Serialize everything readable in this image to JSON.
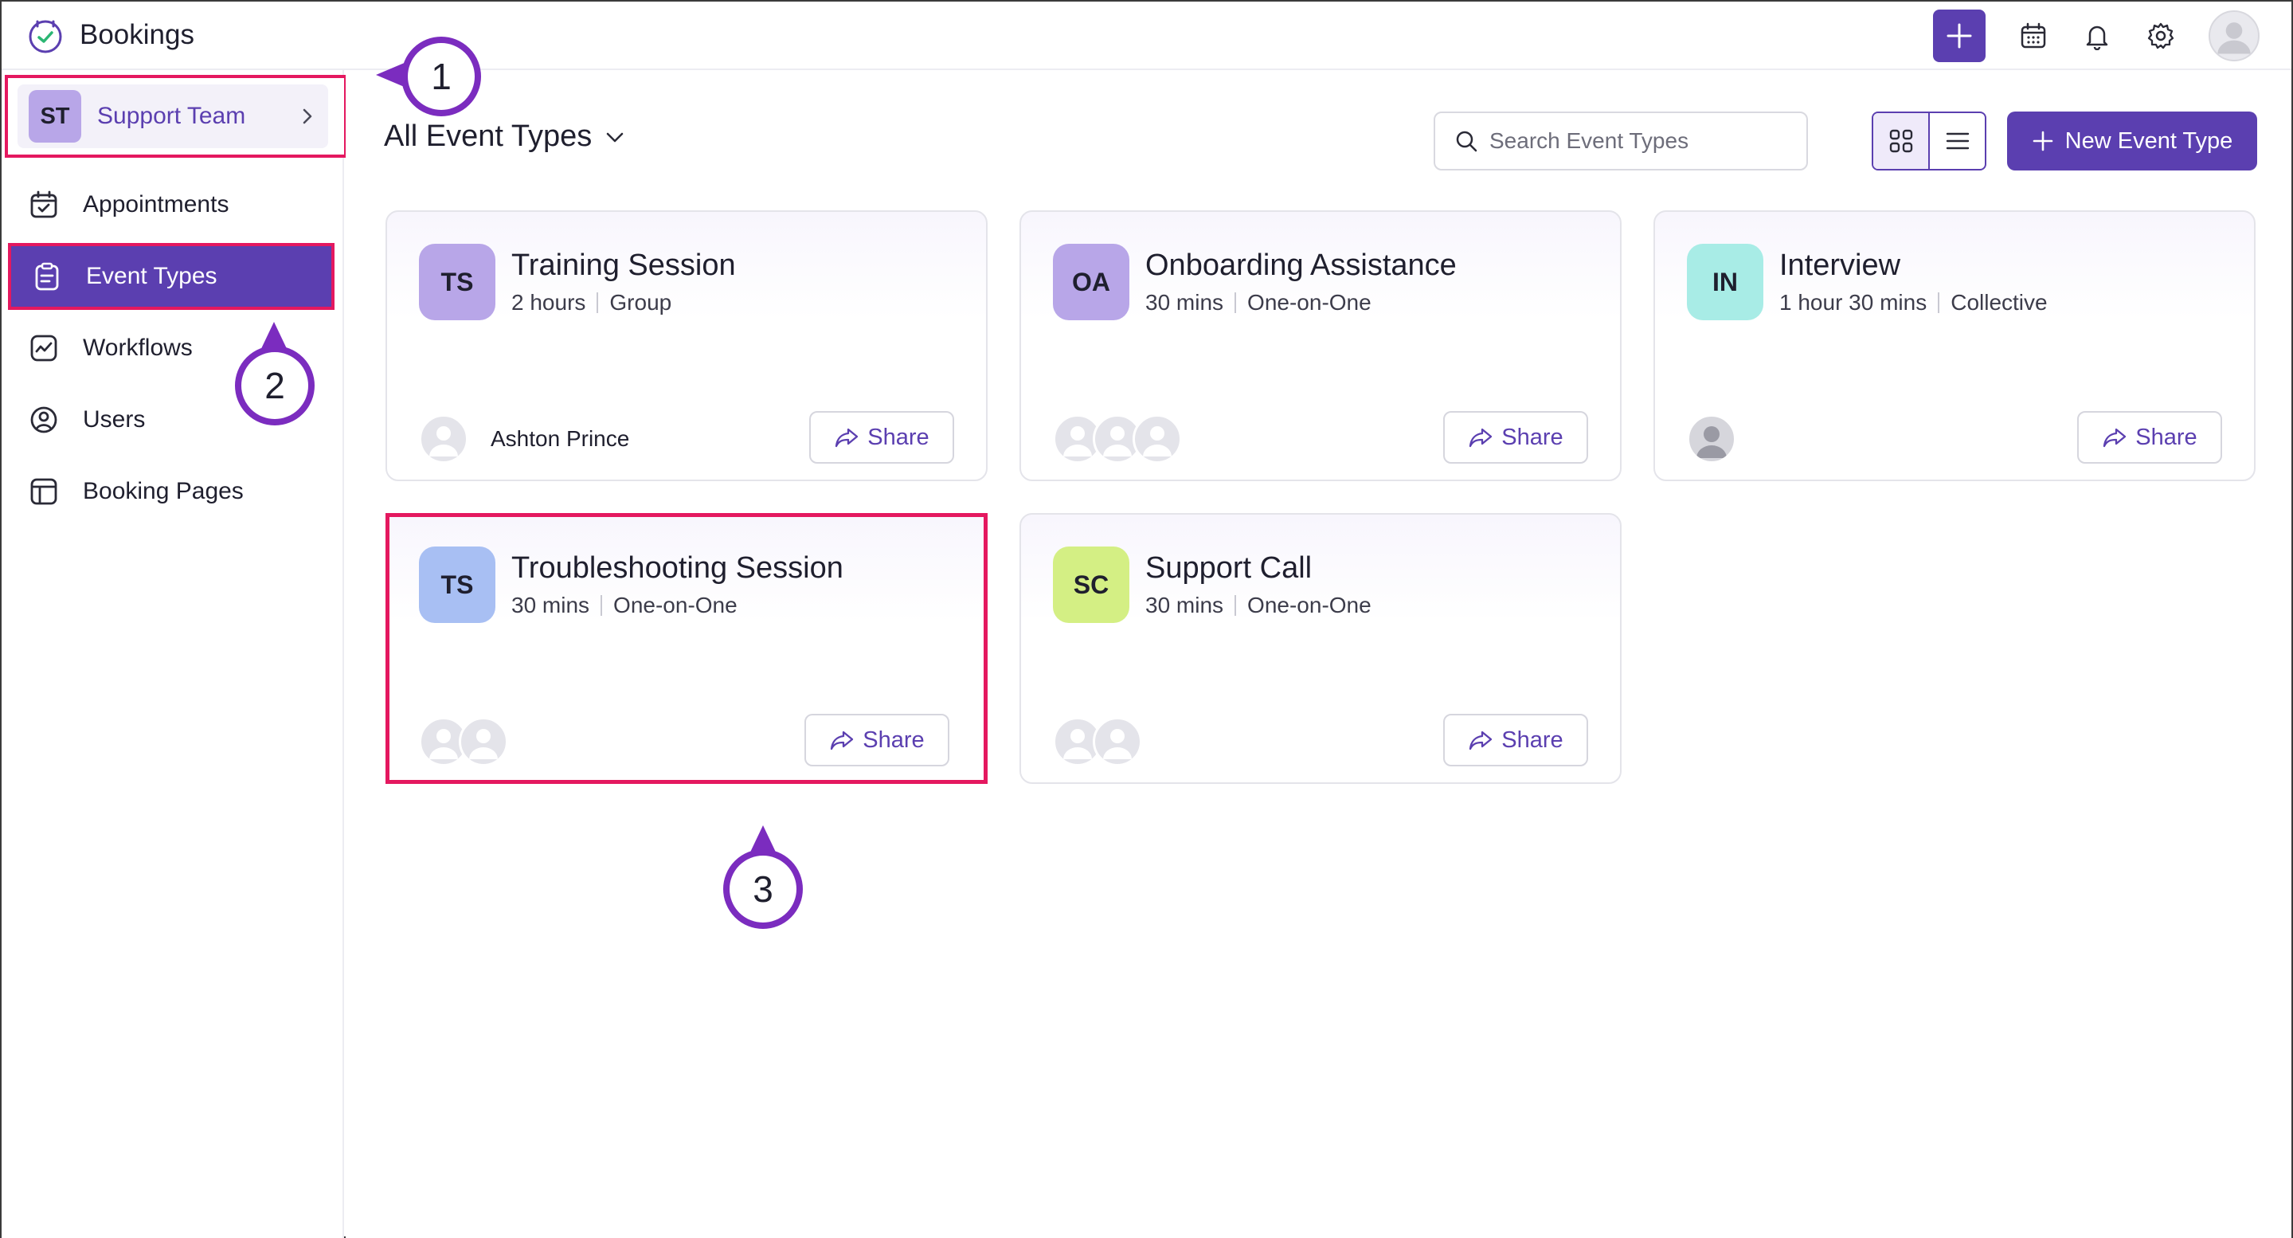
{
  "app": {
    "title": "Bookings"
  },
  "colors": {
    "brand": "#5b3fb0",
    "highlight": "#e4185f",
    "callout": "#7b2cbf"
  },
  "topbar": {
    "icons": [
      "plus-icon",
      "calendar-icon",
      "bell-icon",
      "gear-icon",
      "user-avatar"
    ]
  },
  "team": {
    "initials": "ST",
    "name": "Support Team"
  },
  "sidebar": {
    "items": [
      {
        "label": "Appointments",
        "icon": "calendar-check-icon"
      },
      {
        "label": "Event Types",
        "icon": "clipboard-icon",
        "active": true
      },
      {
        "label": "Workflows",
        "icon": "workflow-icon"
      },
      {
        "label": "Users",
        "icon": "user-circle-icon"
      },
      {
        "label": "Booking Pages",
        "icon": "layout-icon"
      }
    ]
  },
  "main": {
    "heading": "All Event Types",
    "search_placeholder": "Search Event Types",
    "new_button": "New Event Type",
    "share_label": "Share"
  },
  "cards": [
    {
      "initials": "TS",
      "title": "Training Session",
      "duration": "2 hours",
      "kind": "Group",
      "badge_color": "#b8a6e8",
      "owner": "Ashton Prince",
      "avatar_count": 1
    },
    {
      "initials": "OA",
      "title": "Onboarding Assistance",
      "duration": "30 mins",
      "kind": "One-on-One",
      "badge_color": "#b8a6e8",
      "owner": "",
      "avatar_count": 3
    },
    {
      "initials": "IN",
      "title": "Interview",
      "duration": "1 hour 30 mins",
      "kind": "Collective",
      "badge_color": "#a8ece6",
      "owner": "",
      "avatar_count": 1
    },
    {
      "initials": "TS",
      "title": "Troubleshooting Session",
      "duration": "30 mins",
      "kind": "One-on-One",
      "badge_color": "#a8bff3",
      "owner": "",
      "avatar_count": 2
    },
    {
      "initials": "SC",
      "title": "Support Call",
      "duration": "30 mins",
      "kind": "One-on-One",
      "badge_color": "#d4ef84",
      "owner": "",
      "avatar_count": 2
    }
  ],
  "callouts": [
    "1",
    "2",
    "3"
  ]
}
